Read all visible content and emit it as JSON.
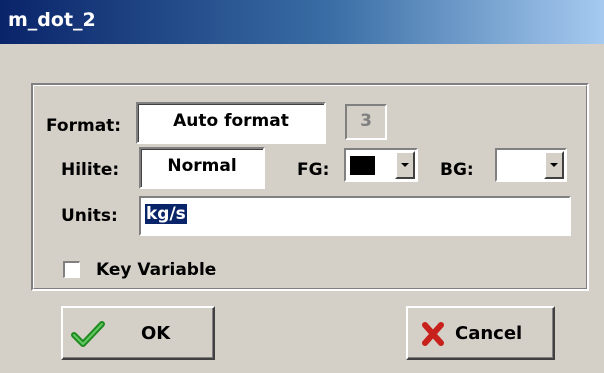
{
  "window": {
    "title": "m_dot_2"
  },
  "format": {
    "label": "Format:",
    "value": "Auto format",
    "digits": "3"
  },
  "hilite": {
    "label": "Hilite:",
    "value": "Normal"
  },
  "fg": {
    "label": "FG:",
    "color": "#000000"
  },
  "bg": {
    "label": "BG:",
    "color": "#ffffff"
  },
  "units": {
    "label": "Units:",
    "value": "kg/s"
  },
  "key_variable": {
    "label": "Key Variable",
    "checked": false
  },
  "buttons": {
    "ok": "OK",
    "cancel": "Cancel"
  },
  "icons": {
    "ok": "green-check-icon",
    "cancel": "red-x-icon"
  }
}
